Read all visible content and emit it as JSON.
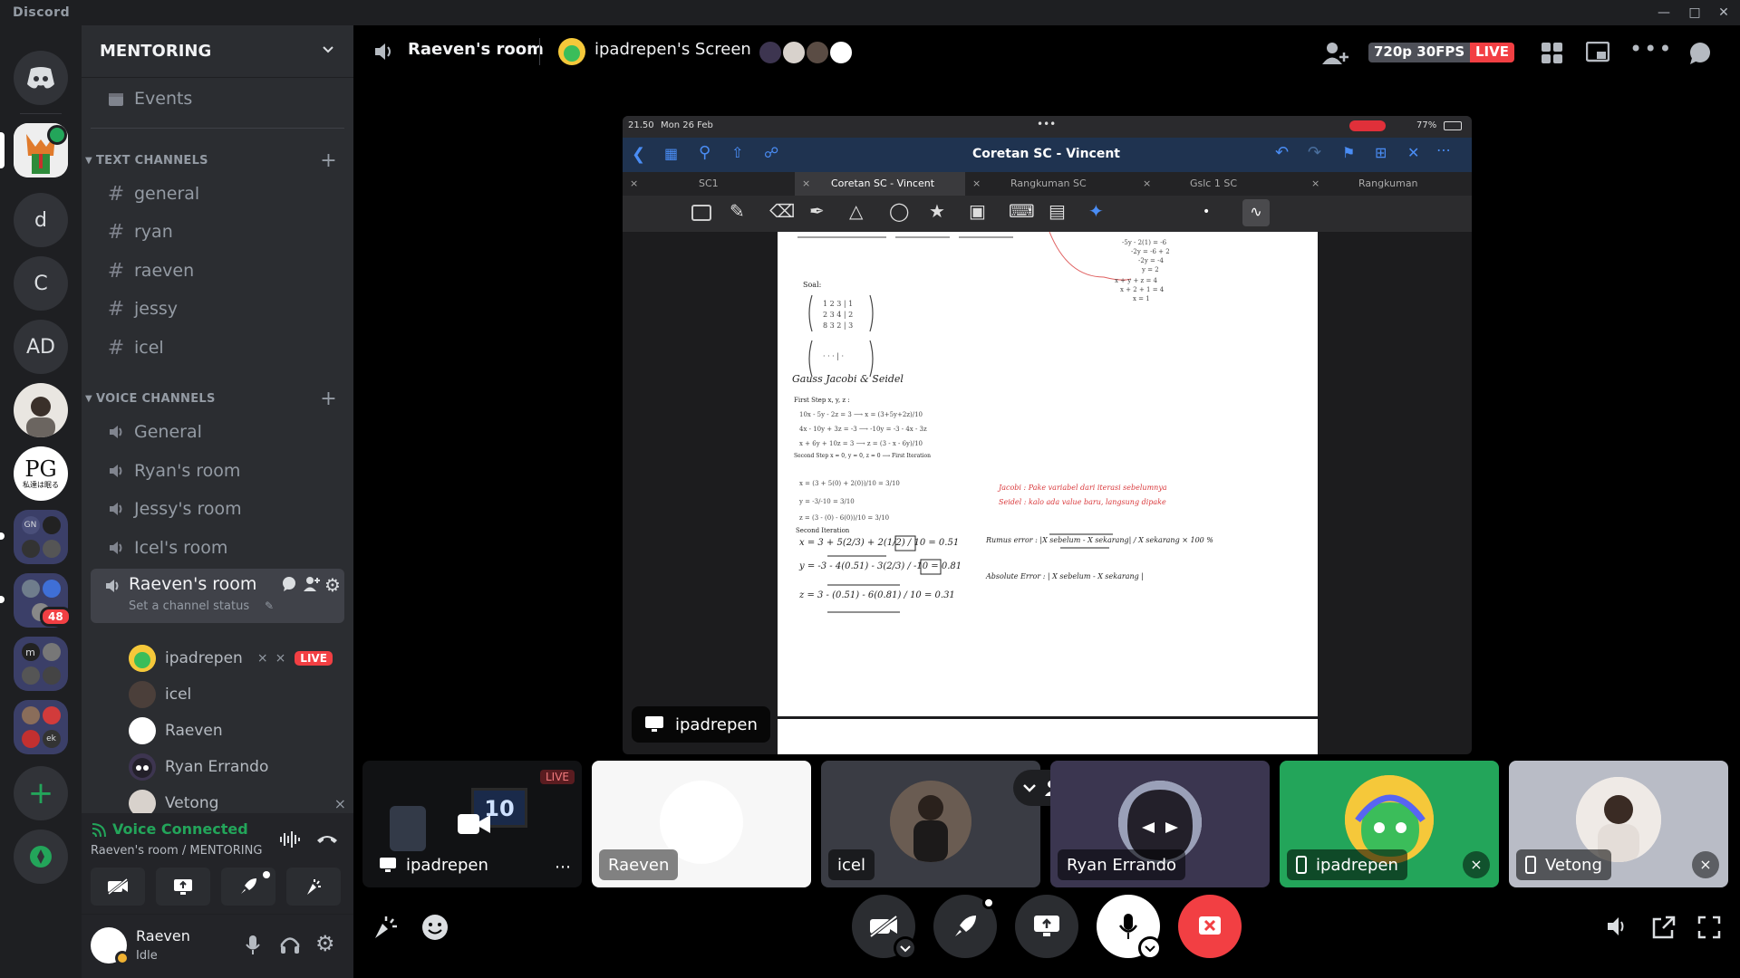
{
  "window": {
    "brand": "Discord"
  },
  "servers": [
    {
      "label": "d"
    },
    {
      "label": "C"
    },
    {
      "label": "AD"
    },
    {
      "label": "PG",
      "sub": "私達は眠る"
    },
    {
      "label": "GN"
    },
    {
      "label": "",
      "badge": "48"
    },
    {
      "label": "m"
    },
    {
      "label": "ek"
    }
  ],
  "sidebar": {
    "guild_name": "MENTORING",
    "events_label": "Events",
    "text_category": "TEXT CHANNELS",
    "text_channels": [
      "general",
      "ryan",
      "raeven",
      "jessy",
      "icel"
    ],
    "voice_category": "VOICE CHANNELS",
    "voice_channels": [
      "General",
      "Ryan's room",
      "Jessy's room",
      "Icel's room"
    ],
    "active_voice": {
      "name": "Raeven's room",
      "status": "Set a channel status"
    },
    "members": [
      {
        "name": "ipadrepen",
        "live": "LIVE"
      },
      {
        "name": "icel"
      },
      {
        "name": "Raeven"
      },
      {
        "name": "Ryan Errando"
      },
      {
        "name": "Vetong"
      }
    ]
  },
  "voice_panel": {
    "status": "Voice Connected",
    "location": "Raeven's room / MENTORING"
  },
  "user_panel": {
    "name": "Raeven",
    "status": "Idle"
  },
  "stage": {
    "room_title": "Raeven's room",
    "screen_title": "ipadrepen's Screen",
    "quality": "720p 30FPS",
    "live": "LIVE",
    "stream_owner": "ipadrepen"
  },
  "ipad": {
    "time": "21.50",
    "date": "Mon 26 Feb",
    "battery": "77%",
    "doc_title": "Coretan SC - Vincent",
    "tabs": [
      "SC1",
      "Coretan SC - Vincent",
      "Rangkuman SC",
      "Gslc 1 SC",
      "Rangkuman"
    ]
  },
  "notes": {
    "soal": "Soal:",
    "heading": "Gauss Jacobi & Seidel",
    "first_step": "First Step   x, y, z :",
    "second_step": "Second Step  x = 0, y = 0, z = 0 ⟶ First Iteration",
    "second_iter": "Second Iteration",
    "x_line": "x = 3 + 5(2/3) + 2(1/2) / 10 = 0.51",
    "y_line": "y = -3 - 4(0.51) - 3(2/3) / -10 = 0.81",
    "z_line": "z = 3 - (0.51) - 6(0.81) / 10 = 0.31",
    "jacobi": "Jacobi : Pake variabel dari iterasi sebelumnya",
    "seidel": "Seidel : kalo ada value baru, langsung dipake",
    "rumus": "Rumus error :  |X sebelum - X sekarang| / X sekarang × 100 %",
    "absolute": "Absolute Error :  | X sebelum - X sekarang |"
  },
  "tiles": [
    {
      "name": "ipadrepen",
      "badge": "LIVE",
      "thumb_text": "10"
    },
    {
      "name": "Raeven"
    },
    {
      "name": "icel"
    },
    {
      "name": "Ryan Errando"
    },
    {
      "name": "ipadrepen"
    },
    {
      "name": "Vetong"
    }
  ],
  "colors": {
    "green": "#23a55a",
    "red": "#f23f43",
    "blurple": "#5865f2"
  }
}
